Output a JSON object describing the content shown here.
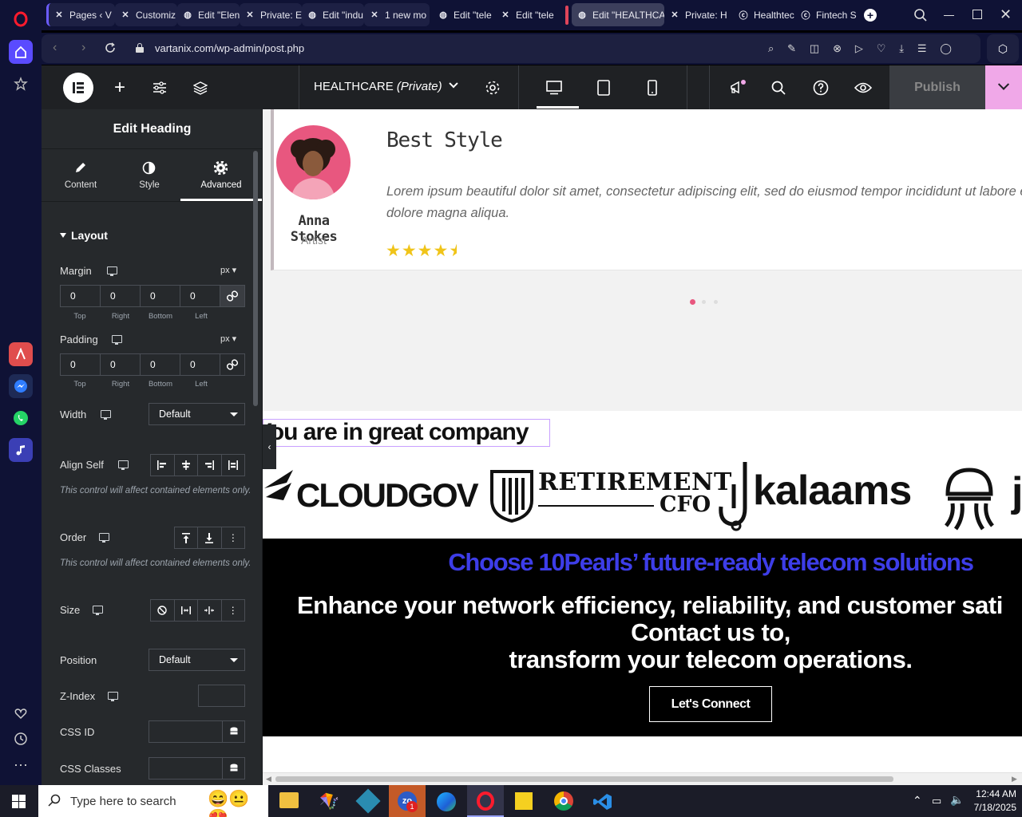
{
  "browser": {
    "tabs": [
      {
        "label": "Pages ‹ V",
        "icon": "x-icon"
      },
      {
        "label": "Customiz",
        "icon": "x-icon"
      },
      {
        "label": "Edit \"Elen",
        "icon": "globe-icon"
      },
      {
        "label": "Private: E",
        "icon": "x-icon"
      },
      {
        "label": "Edit \"indu",
        "icon": "globe-icon"
      },
      {
        "label": "1 new mo",
        "icon": "x-icon"
      },
      {
        "label": "Edit \"tele",
        "icon": "globe-icon"
      },
      {
        "label": "Edit \"tele",
        "icon": "x-icon"
      },
      {
        "label": "Edit \"HEALTHCA",
        "icon": "globe-icon",
        "active": true
      },
      {
        "label": "Private: H",
        "icon": "x-icon"
      },
      {
        "label": "Healthtec",
        "icon": "c-icon"
      },
      {
        "label": "Fintech S",
        "icon": "c-icon"
      }
    ],
    "url": "vartanix.com/wp-admin/post.php"
  },
  "editor": {
    "page_title": "HEALTHCARE",
    "page_status": "(Private)",
    "publish_label": "Publish"
  },
  "panel": {
    "title": "Edit Heading",
    "tabs": [
      "Content",
      "Style",
      "Advanced"
    ],
    "section": "Layout",
    "margin": {
      "label": "Margin",
      "unit": "px",
      "values": [
        "0",
        "0",
        "0",
        "0"
      ],
      "sides": [
        "Top",
        "Right",
        "Bottom",
        "Left"
      ]
    },
    "padding": {
      "label": "Padding",
      "unit": "px",
      "values": [
        "0",
        "0",
        "0",
        "0"
      ],
      "sides": [
        "Top",
        "Right",
        "Bottom",
        "Left"
      ]
    },
    "width": {
      "label": "Width",
      "value": "Default"
    },
    "align_self": {
      "label": "Align Self"
    },
    "contained_note": "This control will affect contained elements only.",
    "order": {
      "label": "Order"
    },
    "size": {
      "label": "Size"
    },
    "position": {
      "label": "Position",
      "value": "Default"
    },
    "zindex": {
      "label": "Z-Index"
    },
    "cssid": {
      "label": "CSS ID"
    },
    "cssclasses": {
      "label": "CSS Classes"
    }
  },
  "canvas": {
    "testimonial": {
      "name": "Anna Stokes",
      "role": "Artist",
      "heading": "Best Style",
      "quote": "Lorem ipsum beautiful dolor sit amet, consectetur adipiscing elit, sed do eiusmod tempor incididunt ut labore et dolore magna aliqua.",
      "rating": 4.5
    },
    "company_heading": "You are in great company",
    "logos": [
      "CLOUDGOV",
      "RETIREMENT",
      "CFO",
      "kalaams",
      "j"
    ],
    "cta_heading": "Choose 10Pearls’ future-ready telecom solutions",
    "cta_line1": "Enhance your network efficiency, reliability, and customer sati",
    "cta_line2": "Contact us to,",
    "cta_line3": "transform your telecom operations.",
    "cta_button": "Let's Connect"
  },
  "taskbar": {
    "search_placeholder": "Type here to search",
    "time": "12:44 AM",
    "date": "7/18/2025",
    "badge": "1"
  }
}
